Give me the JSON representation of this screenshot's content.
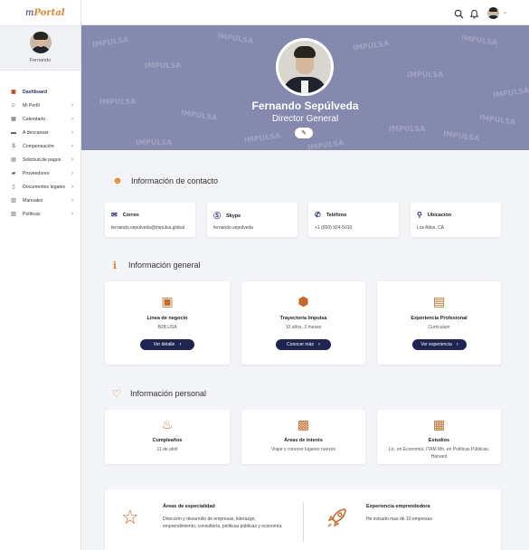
{
  "brand": {
    "logo_prefix": "m",
    "logo_name": "Portal"
  },
  "sidebar": {
    "user_name": "Fernando",
    "items": [
      {
        "label": "Dashboard",
        "icon": "dashboard-icon",
        "has_chevron": false
      },
      {
        "label": "Mi Perfil",
        "icon": "user-icon",
        "has_chevron": true
      },
      {
        "label": "Calendario",
        "icon": "calendar-icon",
        "has_chevron": true
      },
      {
        "label": "A descansar",
        "icon": "bed-icon",
        "has_chevron": true
      },
      {
        "label": "Compensación",
        "icon": "money-icon",
        "has_chevron": true
      },
      {
        "label": "Solicitud de pagos",
        "icon": "payment-icon",
        "has_chevron": true
      },
      {
        "label": "Proveedores",
        "icon": "truck-icon",
        "has_chevron": true
      },
      {
        "label": "Documentos legales",
        "icon": "documents-icon",
        "has_chevron": true
      },
      {
        "label": "Manuales",
        "icon": "book-icon",
        "has_chevron": true
      },
      {
        "label": "Políticas",
        "icon": "policy-icon",
        "has_chevron": true
      }
    ]
  },
  "topbar": {
    "search_icon": "search-icon",
    "bell_icon": "bell-icon",
    "caret": "⌄"
  },
  "hero": {
    "name": "Fernando Sepúlveda",
    "role": "Director General",
    "edit_icon": "pencil-icon",
    "pattern_text": "IMPULSA",
    "background": "#8589ae"
  },
  "contact": {
    "title": "Información de contacto",
    "cards": [
      {
        "label": "Correo",
        "value": "fernando.sepulveda@impulsa.global",
        "icon": "mail-icon"
      },
      {
        "label": "Skype",
        "value": "fernando.sepulveda",
        "icon": "skype-icon"
      },
      {
        "label": "Teléfono",
        "value": "+1 (650) 924-5010",
        "icon": "phone-icon"
      },
      {
        "label": "Ubicación",
        "value": "Los Altos, CA",
        "icon": "location-icon"
      }
    ]
  },
  "general": {
    "title": "Información general",
    "cards": [
      {
        "title": "Línea de negocio",
        "subtitle": "B2B USA",
        "button": "Ver detalle",
        "icon": "briefcase-icon"
      },
      {
        "title": "Trayectoria Impulsa",
        "subtitle": "10 años, 2 meses",
        "button": "Conocer más",
        "icon": "impulsa-logo-icon"
      },
      {
        "title": "Experiencia Profesional",
        "subtitle": "Curriculum",
        "button": "Ver experiencia",
        "icon": "resume-icon"
      }
    ]
  },
  "personal": {
    "title": "Información personal",
    "cards": [
      {
        "title": "Cumpleaños",
        "subtitle": "11 de abril",
        "icon": "cake-icon"
      },
      {
        "title": "Áreas de interés",
        "subtitle": "Viajar y conocer lugares nuevos",
        "icon": "interests-icon"
      },
      {
        "title": "Estudios",
        "subtitle": "Lic. en Economía, ITAM Mtr. en Políticas Públicas, Harvard",
        "icon": "diploma-icon"
      }
    ]
  },
  "expertise": {
    "title": "Áreas de especialidad",
    "text": "Dirección y desarrollo de empresas, liderazgo, emprendimiento, consultoría, políticas públicas y economía.",
    "icon": "star-icon"
  },
  "entrepreneur": {
    "title": "Experiencia emprendedora",
    "text": "He iniciado mas de 10 empresas",
    "icon": "rocket-icon"
  },
  "colors": {
    "navy": "#1f2550",
    "accent": "#e0862e",
    "page_bg": "#f3f4f7"
  }
}
